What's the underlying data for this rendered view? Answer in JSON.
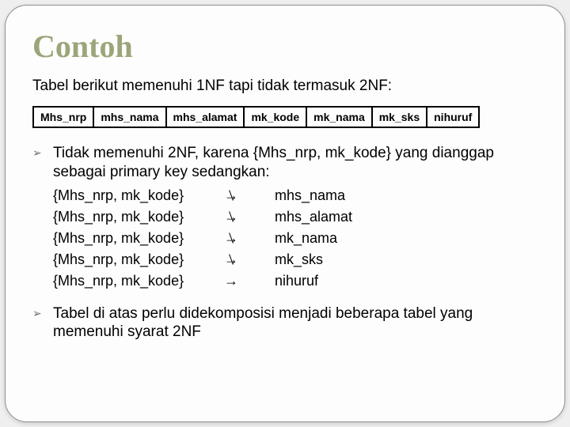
{
  "title": "Contoh",
  "intro": "Tabel berikut memenuhi 1NF tapi tidak termasuk 2NF:",
  "columns": [
    "Mhs_nrp",
    "mhs_nama",
    "mhs_alamat",
    "mk_kode",
    "mk_nama",
    "mk_sks",
    "nihuruf"
  ],
  "bullet_glyph": "➢",
  "arrow_glyph": "→",
  "point1": "Tidak memenuhi 2NF, karena {Mhs_nrp, mk_kode} yang dianggap sebagai primary key sedangkan:",
  "deps": [
    {
      "lhs": "{Mhs_nrp, mk_kode}",
      "rhs": "mhs_nama",
      "slashed": true
    },
    {
      "lhs": "{Mhs_nrp, mk_kode}",
      "rhs": "mhs_alamat",
      "slashed": true
    },
    {
      "lhs": "{Mhs_nrp, mk_kode}",
      "rhs": "mk_nama",
      "slashed": true
    },
    {
      "lhs": "{Mhs_nrp, mk_kode}",
      "rhs": "mk_sks",
      "slashed": true
    },
    {
      "lhs": "{Mhs_nrp, mk_kode}",
      "rhs": "nihuruf",
      "slashed": false
    }
  ],
  "point2": "Tabel di atas perlu didekomposisi menjadi beberapa tabel yang memenuhi syarat 2NF"
}
